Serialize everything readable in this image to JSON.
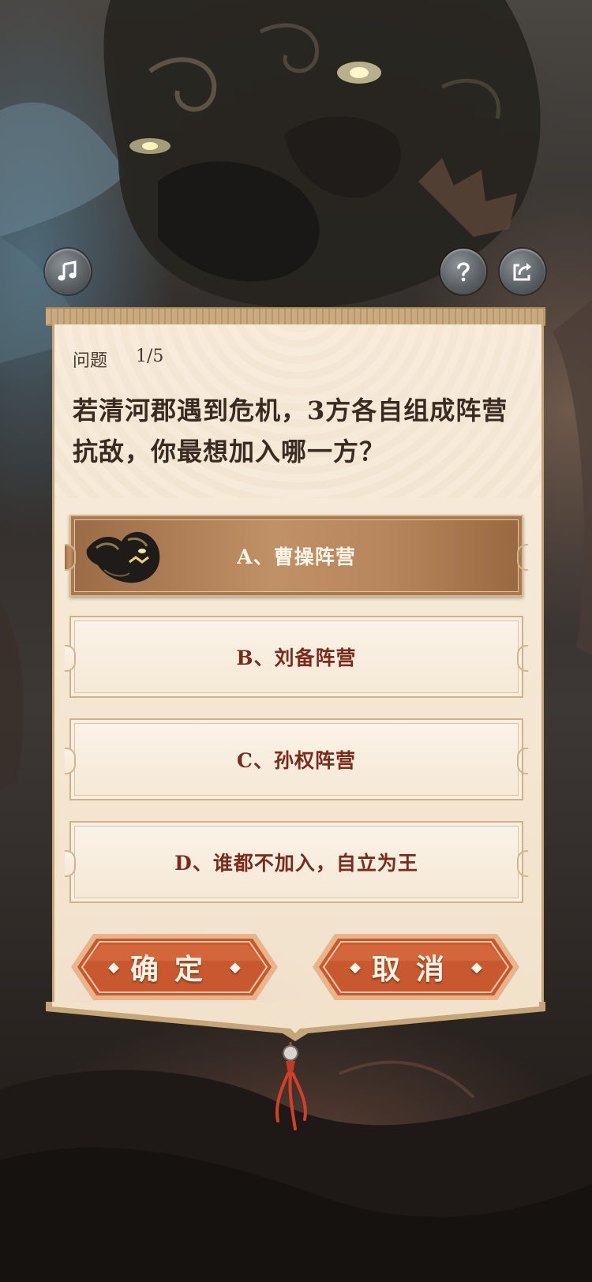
{
  "toolbar": {
    "music_icon": "music-note-icon",
    "help_icon": "question-mark-icon",
    "share_icon": "share-icon"
  },
  "question": {
    "label": "问题",
    "progress": "1/5",
    "text": "若清河郡遇到危机，3方各自组成阵营抗敌，你最想加入哪一方？"
  },
  "options": [
    {
      "label": "A、曹操阵营",
      "selected": true,
      "emblem_icon": "dark-beast-emblem-icon"
    },
    {
      "label": "B、刘备阵营",
      "selected": false
    },
    {
      "label": "C、孙权阵营",
      "selected": false
    },
    {
      "label": "D、谁都不加入，自立为王",
      "selected": false
    }
  ],
  "actions": {
    "confirm_label": "确定",
    "cancel_label": "取消"
  },
  "colors": {
    "accent_red": "#c8582f",
    "paper": "#f4e6d1",
    "selected_option": "#b8865c"
  }
}
